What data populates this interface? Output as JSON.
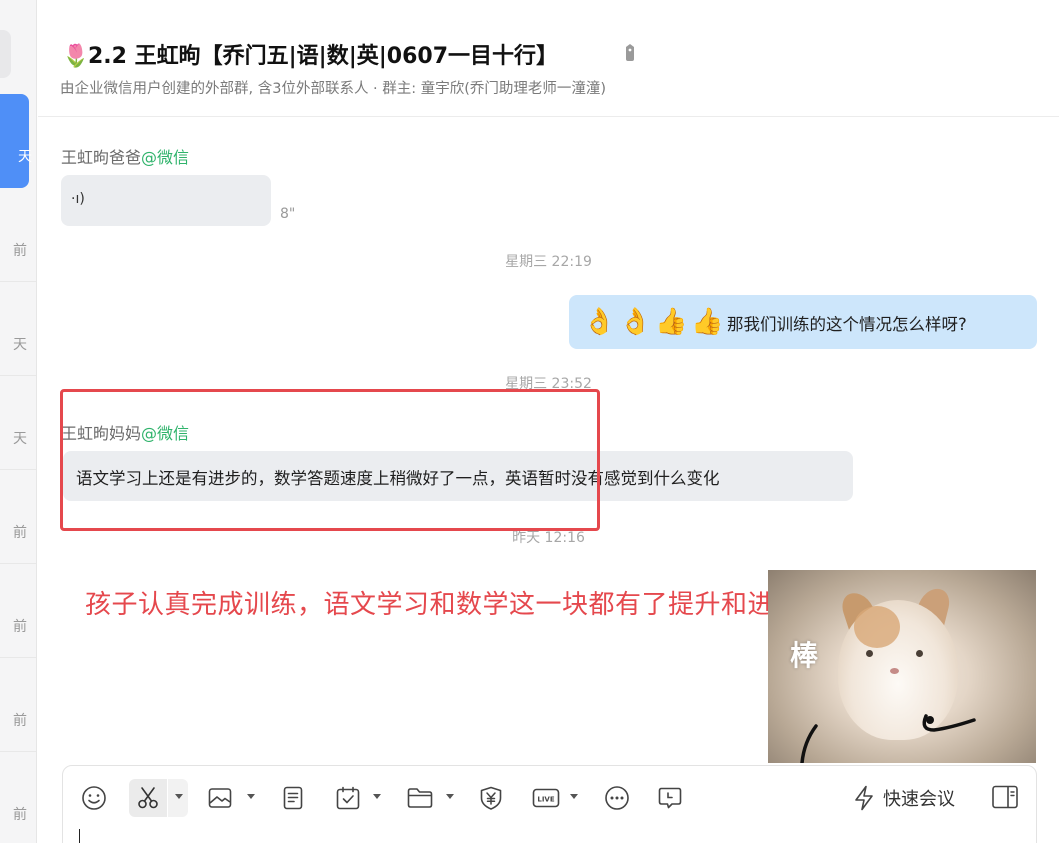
{
  "sidebar": {
    "items": [
      {
        "time": "天",
        "active": true
      },
      {
        "time": "前"
      },
      {
        "time": "天"
      },
      {
        "time": "天"
      },
      {
        "time": "前"
      },
      {
        "time": "前"
      },
      {
        "time": "前"
      },
      {
        "time": "前"
      }
    ]
  },
  "header": {
    "title_emoji": "🌷",
    "title": "2.2 王虹昫【乔门五|语|数|英|0607一目十行】",
    "subtitle": "由企业微信用户创建的外部群, 含3位外部联系人 · 群主: 童宇欣(乔门助理老师一潼潼)"
  },
  "messages": {
    "msg1": {
      "sender": "王虹昫爸爸",
      "source": "@微信",
      "voice_icon": "·ı)",
      "duration": "8\""
    },
    "ts1": "星期三 22:19",
    "msg2": {
      "emojis": [
        "👌",
        "👌",
        "👍",
        "👍"
      ],
      "text": "那我们训练的这个情况怎么样呀?"
    },
    "ts2": "星期三 23:52",
    "msg3": {
      "sender": "王虹昫妈妈",
      "source": "@微信",
      "text": "语文学习上还是有进步的，数学答题速度上稍微好了一点，英语暂时没有感觉到什么变化"
    },
    "ts3": "昨天 12:16",
    "annotation": "孩子认真完成训练，语文学习和数学这一块都有了提升和进步",
    "sticker_word": "棒"
  },
  "composer": {
    "quick_meeting": "快速会议",
    "tools": [
      "emoji-icon",
      "scissors-icon",
      "image-icon",
      "document-icon",
      "calendar-check-icon",
      "folder-icon",
      "yuan-icon",
      "live-icon",
      "more-icon",
      "chat-bubble-icon"
    ],
    "live_label": "LIVE"
  },
  "colors": {
    "accent": "#4f8ff7",
    "my_bubble": "#cde6fb",
    "their_bubble": "#ebedf0",
    "annotation_red": "#e5484d",
    "wechat_green": "#2fb36b"
  }
}
